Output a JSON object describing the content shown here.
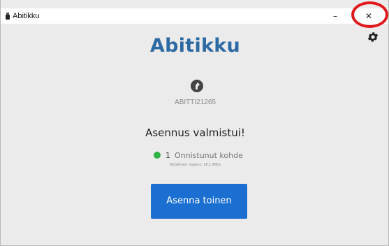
{
  "window": {
    "title": "Abitikku",
    "minimize_symbol": "–",
    "close_symbol": "✕"
  },
  "header": {
    "logo_text": "Abitikku"
  },
  "device": {
    "id": "ABITTI21265",
    "icon": "usb-drive-icon"
  },
  "status": {
    "title": "Asennus valmistui!",
    "success_count": "1",
    "success_label": "Onnistunut kohde",
    "speed_text": "Todellinen nopeus: 18.1 MB/s",
    "success_color": "#2fb344"
  },
  "actions": {
    "install_another_label": "Asenna toinen"
  },
  "colors": {
    "accent": "#1a6fd0",
    "logo": "#2d6aa3",
    "highlight": "#e0191c"
  }
}
